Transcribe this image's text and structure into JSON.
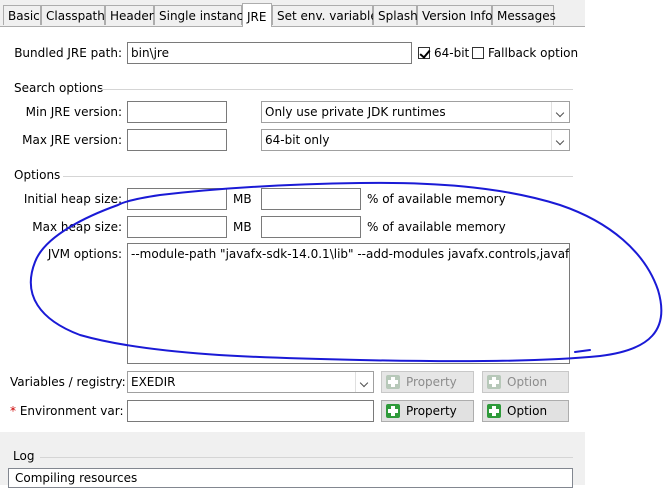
{
  "tabs": [
    "Basic",
    "Classpath",
    "Header",
    "Single instance",
    "JRE",
    "Set env. variables",
    "Splash",
    "Version Info",
    "Messages"
  ],
  "active_tab": "JRE",
  "bundled_jre": {
    "label": "Bundled JRE path:",
    "value": "bin\\jre",
    "bit64_label": "64-bit",
    "bit64_checked": true,
    "fallback_label": "Fallback option",
    "fallback_checked": false
  },
  "search_options": {
    "title": "Search options",
    "min_label": "Min JRE version:",
    "min_value": "",
    "max_label": "Max JRE version:",
    "max_value": "",
    "runtime_select": "Only use private JDK runtimes",
    "arch_select": "64-bit only"
  },
  "options": {
    "title": "Options",
    "initial_heap_label": "Initial heap size:",
    "max_heap_label": "Max heap size:",
    "mb": "MB",
    "pct_label": "% of available memory",
    "jvm_label": "JVM options:",
    "jvm_value": "--module-path \"javafx-sdk-14.0.1\\lib\" --add-modules javafx.controls,javafx.fxml",
    "vars_label": "Variables / registry:",
    "vars_select": "EXEDIR",
    "env_label": "Environment var:",
    "env_star": "*",
    "property_btn": "Property",
    "option_btn": "Option"
  },
  "log": {
    "title": "Log",
    "text": "Compiling resources"
  },
  "colors": {
    "annotation": "#1a1ad6",
    "checkbox_mark": "#000000",
    "plus_icon": "#2e9a3a"
  }
}
